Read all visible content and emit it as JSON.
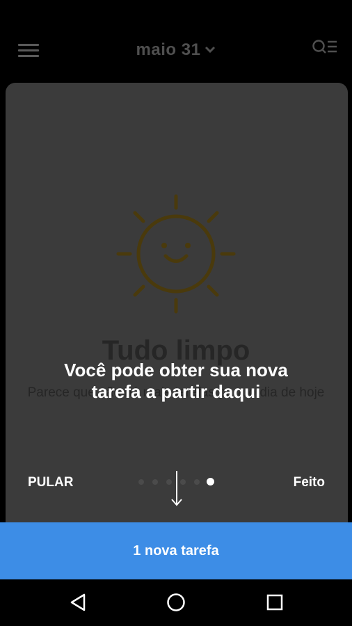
{
  "header": {
    "date_label": "maio 31",
    "chevron_icon": "chevron-down-icon",
    "menu_icon": "hamburger-menu-icon",
    "search_icon": "search-list-icon"
  },
  "empty_state": {
    "icon": "smiling-sun-icon",
    "title": "Tudo limpo",
    "subtitle": "Parece que não há mais tarefas para o dia de hoje"
  },
  "tutorial": {
    "tip": "Você pode obter sua nova tarefa a partir daqui",
    "skip_label": "PULAR",
    "done_label": "Feito",
    "page_count": 6,
    "current_page": 6,
    "pointer_icon": "arrow-down-icon"
  },
  "bottom_action": {
    "label": "1 nova tarefa"
  },
  "colors": {
    "accent": "#3d8de6",
    "card": "#3b3b3b",
    "sun": "#4a3a0c"
  },
  "system_nav": {
    "back_icon": "back-triangle-icon",
    "home_icon": "home-circle-icon",
    "recent_icon": "recent-square-icon"
  }
}
